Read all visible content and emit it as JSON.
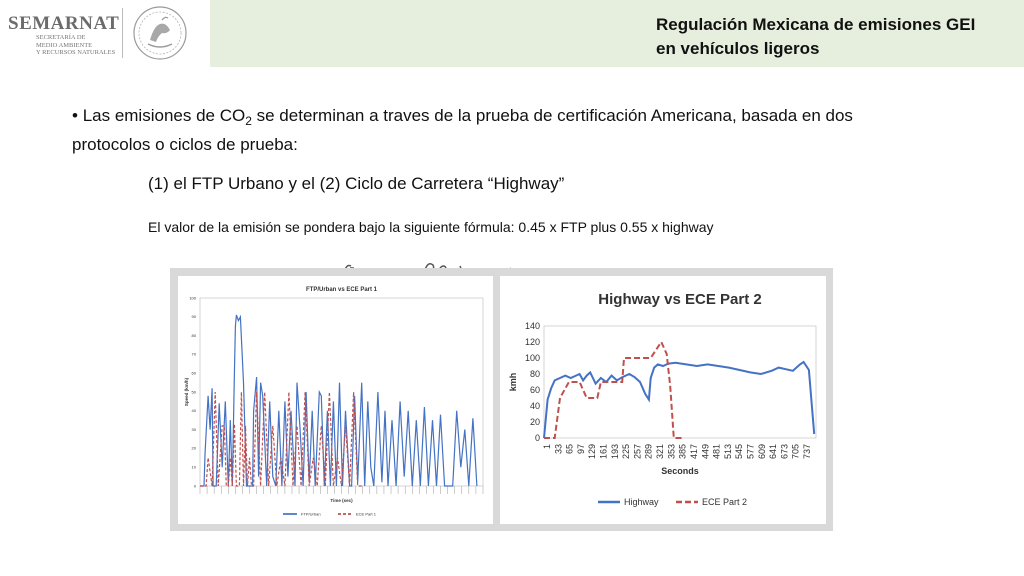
{
  "header": {
    "logo_wordmark": "SEMARNAT",
    "logo_sub": [
      "SECRETARÍA DE",
      "MEDIO AMBIENTE",
      "Y RECURSOS NATURALES"
    ],
    "title_line1": "Regulación Mexicana de emisiones GEI",
    "title_line2": "en vehículos ligeros"
  },
  "body": {
    "bullet": "•",
    "p1_a": "Las emisiones de CO",
    "p1_sub": "2",
    "p1_b": " se determinan a traves de la prueba de certificación Americana, basada en dos protocolos o ciclos de prueba:",
    "p2": "(1) el FTP Urbano y el (2) Ciclo de Carretera “Highway”",
    "p3": "El valor de la emisión se pondera bajo la siguiente fórmula:  0.45 x FTP plus 0.55 x highway"
  },
  "chart_data": [
    {
      "type": "line",
      "title": "FTP/Urban vs ECE Part 1",
      "xlabel": "Time (sec)",
      "ylabel": "Speed (km/h)",
      "ylim": [
        0,
        100
      ],
      "yticks": [
        0,
        10,
        20,
        30,
        40,
        50,
        60,
        70,
        80,
        90,
        100
      ],
      "xlim": [
        0,
        1400
      ],
      "series": [
        {
          "name": "FTP/Urban",
          "color": "#4472c4",
          "x": [
            0,
            20,
            25,
            40,
            50,
            60,
            65,
            80,
            95,
            110,
            125,
            140,
            150,
            160,
            170,
            175,
            180,
            190,
            200,
            215,
            230,
            250,
            260,
            265,
            280,
            290,
            300,
            310,
            330,
            345,
            360,
            375,
            390,
            405,
            420,
            435,
            450,
            470,
            480,
            495,
            510,
            525,
            540,
            555,
            570,
            590,
            600,
            615,
            630,
            645,
            660,
            675,
            690,
            705,
            720,
            740,
            750,
            765,
            780,
            800,
            815,
            830,
            845,
            860,
            880,
            900,
            915,
            930,
            950,
            970,
            990,
            1010,
            1030,
            1050,
            1070,
            1090,
            1110,
            1130,
            1150,
            1170,
            1190,
            1210,
            1230,
            1250,
            1270,
            1290,
            1310,
            1330,
            1350,
            1370
          ],
          "y": [
            0,
            0,
            18,
            48,
            30,
            52,
            0,
            0,
            44,
            10,
            45,
            0,
            35,
            0,
            60,
            85,
            91,
            88,
            90,
            55,
            0,
            0,
            0,
            40,
            58,
            5,
            55,
            48,
            0,
            45,
            5,
            0,
            40,
            0,
            45,
            5,
            40,
            0,
            55,
            30,
            0,
            50,
            2,
            40,
            0,
            50,
            48,
            0,
            40,
            0,
            45,
            0,
            55,
            0,
            40,
            0,
            0,
            48,
            2,
            55,
            0,
            45,
            10,
            0,
            50,
            2,
            40,
            0,
            35,
            0,
            45,
            5,
            40,
            0,
            35,
            0,
            42,
            0,
            35,
            0,
            38,
            0,
            0,
            0,
            40,
            10,
            30,
            0,
            36,
            0
          ]
        },
        {
          "name": "ECE Part 1",
          "color": "#c0504d",
          "x": [
            0,
            30,
            40,
            60,
            75,
            90,
            110,
            120,
            130,
            140,
            150,
            160,
            170,
            180,
            195,
            205,
            215,
            225,
            235,
            245,
            255,
            265,
            280,
            300,
            320,
            340,
            360,
            380,
            400,
            420,
            440,
            460,
            480,
            500,
            520,
            540,
            560,
            580,
            600,
            620,
            640,
            660,
            680,
            700,
            720,
            740,
            760,
            780,
            800
          ],
          "y": [
            0,
            0,
            15,
            0,
            50,
            0,
            32,
            32,
            0,
            0,
            15,
            0,
            33,
            0,
            0,
            50,
            0,
            32,
            0,
            15,
            0,
            0,
            50,
            0,
            50,
            0,
            32,
            0,
            15,
            0,
            50,
            0,
            32,
            0,
            50,
            0,
            15,
            0,
            32,
            0,
            50,
            0,
            15,
            0,
            32,
            0,
            50,
            0,
            0
          ]
        }
      ],
      "legend": "bottom",
      "grid": false
    },
    {
      "type": "line",
      "title": "Highway vs ECE Part 2",
      "xlabel": "Seconds",
      "ylabel": "kmh",
      "ylim": [
        0,
        140
      ],
      "yticks": [
        0,
        20,
        40,
        60,
        80,
        100,
        120,
        140
      ],
      "categories": [
        "1",
        "33",
        "65",
        "97",
        "129",
        "161",
        "193",
        "225",
        "257",
        "289",
        "321",
        "353",
        "385",
        "417",
        "449",
        "481",
        "513",
        "545",
        "577",
        "609",
        "641",
        "673",
        "705",
        "737"
      ],
      "xlim": [
        0,
        765
      ],
      "series": [
        {
          "name": "Highway",
          "color": "#4472c4",
          "x": [
            0,
            10,
            20,
            30,
            45,
            60,
            75,
            90,
            100,
            110,
            120,
            130,
            145,
            160,
            175,
            190,
            205,
            220,
            240,
            255,
            270,
            285,
            295,
            300,
            310,
            320,
            335,
            350,
            370,
            400,
            430,
            460,
            490,
            520,
            550,
            580,
            610,
            640,
            660,
            680,
            700,
            720,
            730,
            745,
            760
          ],
          "y": [
            0,
            48,
            62,
            72,
            75,
            78,
            75,
            78,
            80,
            72,
            78,
            82,
            68,
            75,
            70,
            78,
            72,
            76,
            80,
            76,
            70,
            55,
            48,
            75,
            88,
            92,
            90,
            93,
            94,
            92,
            90,
            92,
            90,
            88,
            85,
            82,
            80,
            84,
            88,
            86,
            84,
            92,
            95,
            85,
            5
          ]
        },
        {
          "name": "ECE Part 2",
          "color": "#c0504d",
          "x": [
            0,
            30,
            45,
            70,
            100,
            120,
            130,
            150,
            160,
            185,
            220,
            225,
            270,
            290,
            300,
            330,
            345,
            355,
            365,
            395
          ],
          "y": [
            0,
            0,
            50,
            70,
            70,
            50,
            50,
            50,
            70,
            70,
            70,
            100,
            100,
            100,
            100,
            120,
            105,
            65,
            0,
            0
          ]
        }
      ],
      "legend": "bottom",
      "grid": false
    }
  ]
}
